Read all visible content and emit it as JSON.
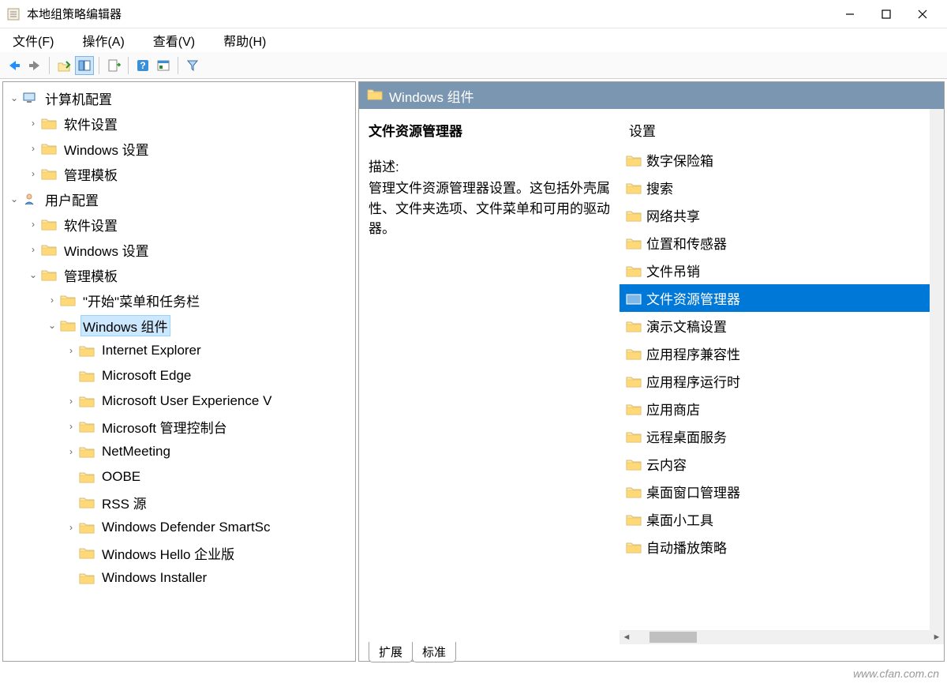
{
  "window": {
    "title": "本地组策略编辑器"
  },
  "menu": {
    "file": "文件(F)",
    "action": "操作(A)",
    "view": "查看(V)",
    "help": "帮助(H)"
  },
  "tree": {
    "computer_config": "计算机配置",
    "software_settings": "软件设置",
    "windows_settings": "Windows 设置",
    "admin_templates": "管理模板",
    "user_config": "用户配置",
    "start_taskbar": "\"开始\"菜单和任务栏",
    "windows_components": "Windows 组件",
    "ie": "Internet Explorer",
    "edge": "Microsoft Edge",
    "mue": "Microsoft User Experience V",
    "mmc": "Microsoft 管理控制台",
    "netmeeting": "NetMeeting",
    "oobe": "OOBE",
    "rss": "RSS 源",
    "defender": "Windows Defender SmartSc",
    "hello": "Windows Hello 企业版",
    "installer": "Windows Installer"
  },
  "detail": {
    "header": "Windows 组件",
    "heading": "文件资源管理器",
    "desc_label": "描述:",
    "desc": "管理文件资源管理器设置。这包括外壳属性、文件夹选项、文件菜单和可用的驱动器。",
    "settings_col": "设置",
    "items": [
      "数字保险箱",
      "搜索",
      "网络共享",
      "位置和传感器",
      "文件吊销",
      "文件资源管理器",
      "演示文稿设置",
      "应用程序兼容性",
      "应用程序运行时",
      "应用商店",
      "远程桌面服务",
      "云内容",
      "桌面窗口管理器",
      "桌面小工具",
      "自动播放策略"
    ],
    "selected_index": 5
  },
  "tabs": {
    "extended": "扩展",
    "standard": "标准"
  },
  "watermark": "www.cfan.com.cn"
}
